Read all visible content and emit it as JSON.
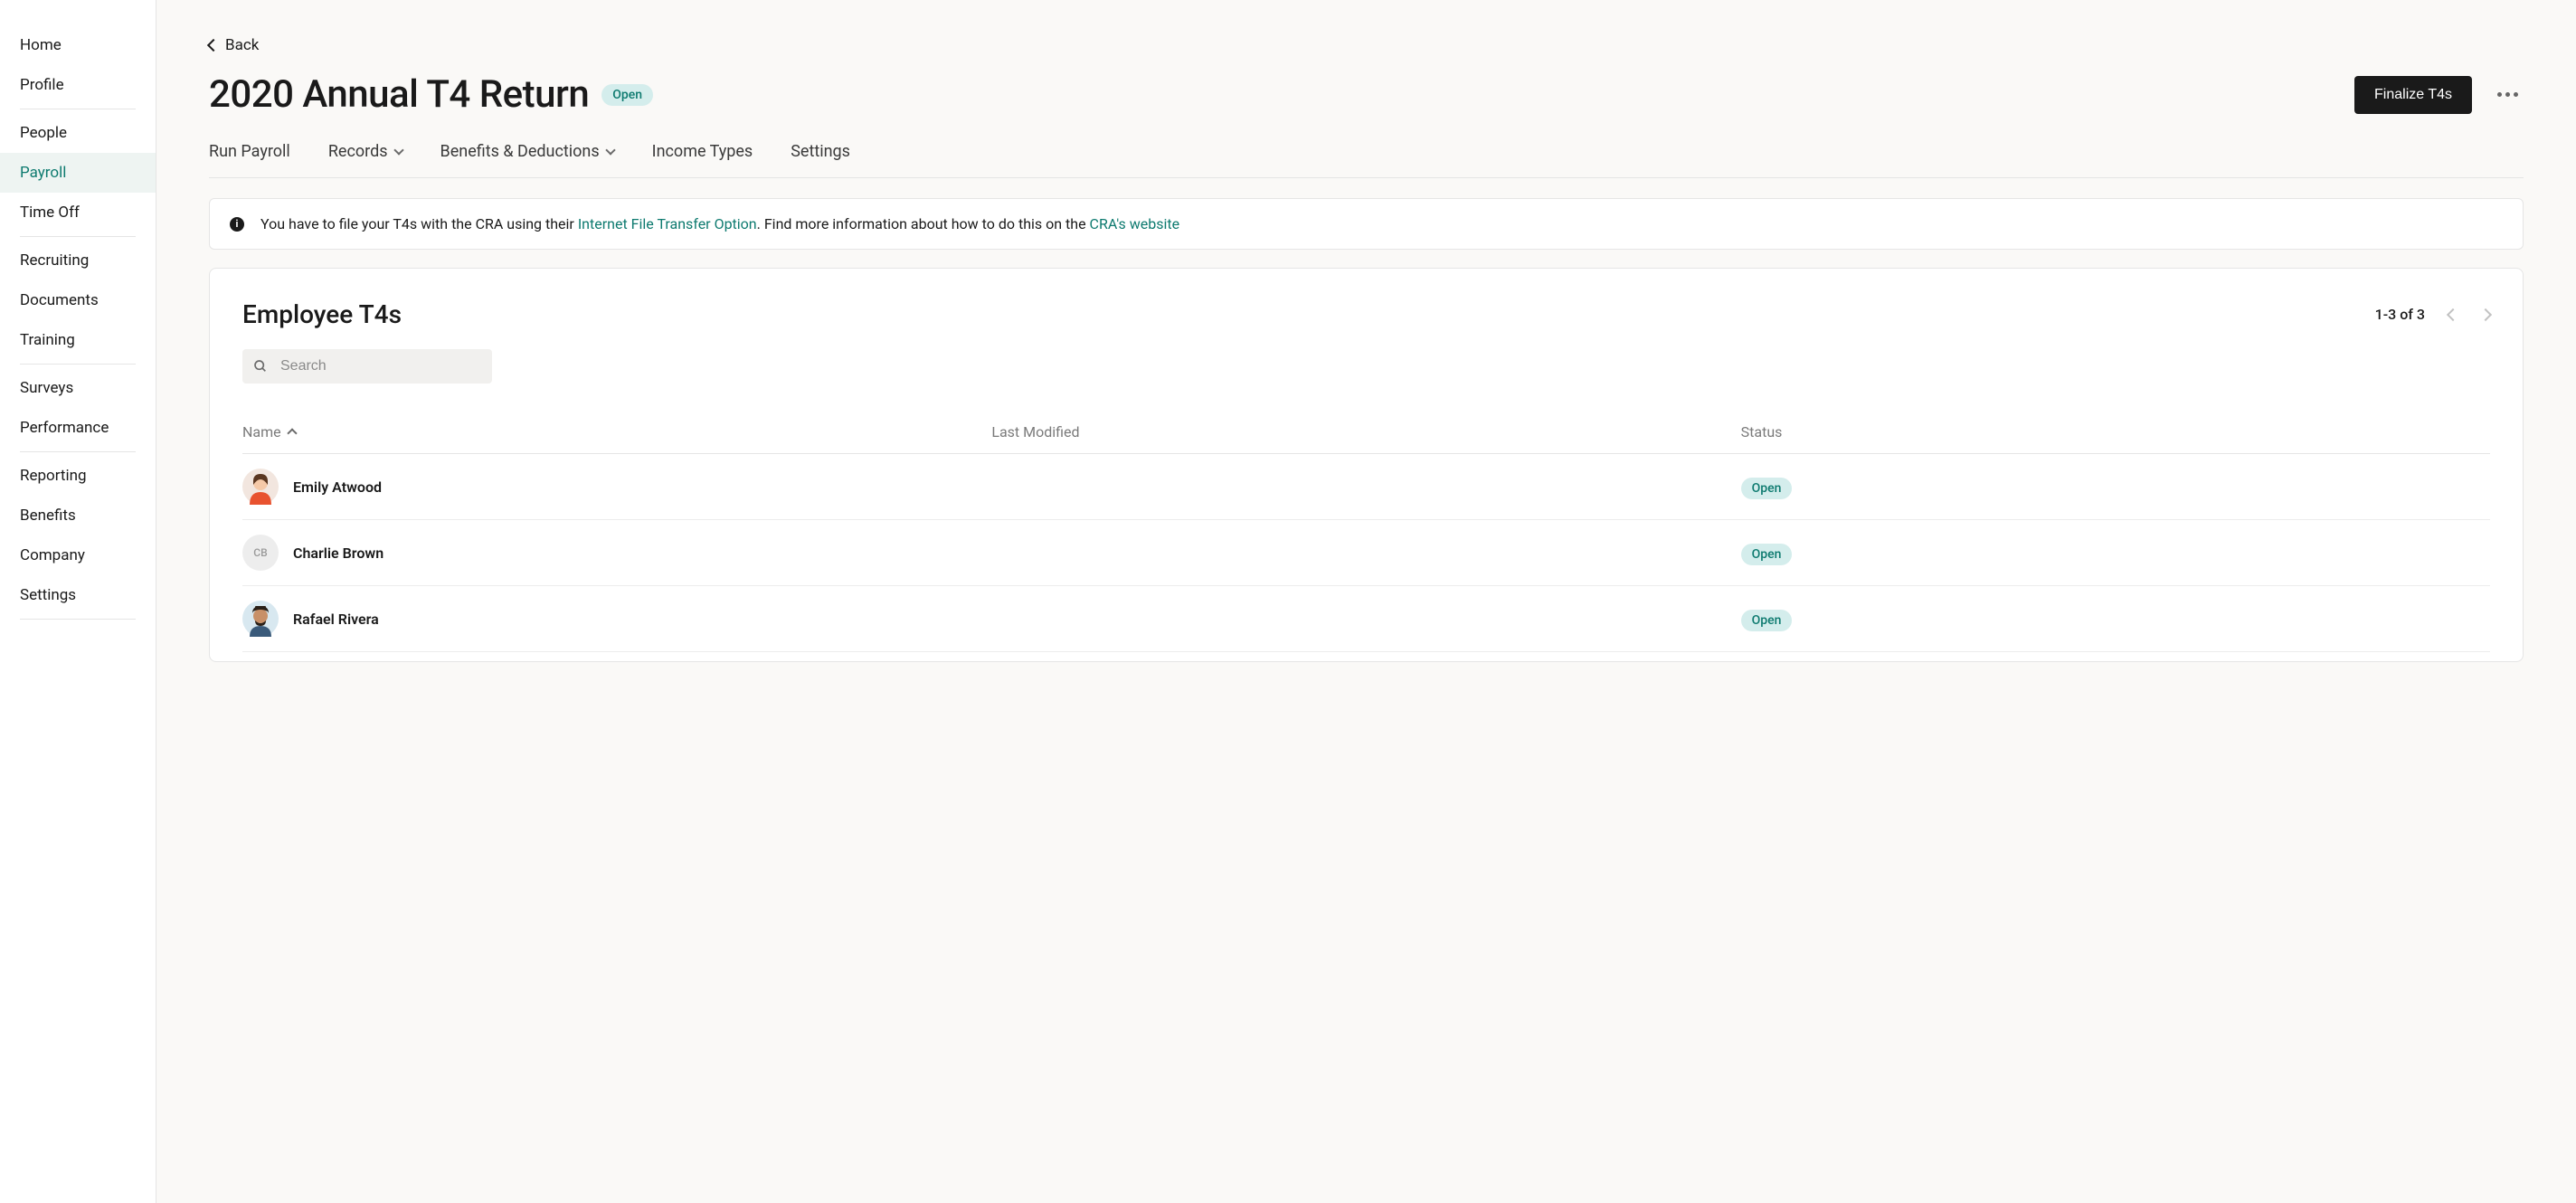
{
  "sidebar": {
    "items": [
      {
        "label": "Home"
      },
      {
        "label": "Profile"
      },
      {
        "label": "People"
      },
      {
        "label": "Payroll",
        "active": true
      },
      {
        "label": "Time Off"
      },
      {
        "label": "Recruiting"
      },
      {
        "label": "Documents"
      },
      {
        "label": "Training"
      },
      {
        "label": "Surveys"
      },
      {
        "label": "Performance"
      },
      {
        "label": "Reporting"
      },
      {
        "label": "Benefits"
      },
      {
        "label": "Company"
      },
      {
        "label": "Settings"
      }
    ]
  },
  "back_label": "Back",
  "page_title": "2020 Annual T4 Return",
  "page_status": "Open",
  "finalize_label": "Finalize T4s",
  "tabs": {
    "run_payroll": "Run Payroll",
    "records": "Records",
    "benefits_deductions": "Benefits & Deductions",
    "income_types": "Income Types",
    "settings": "Settings"
  },
  "info_banner": {
    "text_before": "You have to file your T4s with the CRA using their ",
    "link1": "Internet File Transfer Option",
    "text_middle": ". Find more information about how to do this on the ",
    "link2": "CRA's website"
  },
  "panel": {
    "title": "Employee T4s",
    "pagination_text": "1-3 of 3",
    "search_placeholder": "Search",
    "columns": {
      "name": "Name",
      "last_modified": "Last Modified",
      "status": "Status"
    },
    "rows": [
      {
        "name": "Emily Atwood",
        "last_modified": "",
        "status": "Open",
        "avatar_type": "illustration1",
        "initials": ""
      },
      {
        "name": "Charlie Brown",
        "last_modified": "",
        "status": "Open",
        "avatar_type": "initials",
        "initials": "CB"
      },
      {
        "name": "Rafael Rivera",
        "last_modified": "",
        "status": "Open",
        "avatar_type": "illustration2",
        "initials": ""
      }
    ]
  }
}
